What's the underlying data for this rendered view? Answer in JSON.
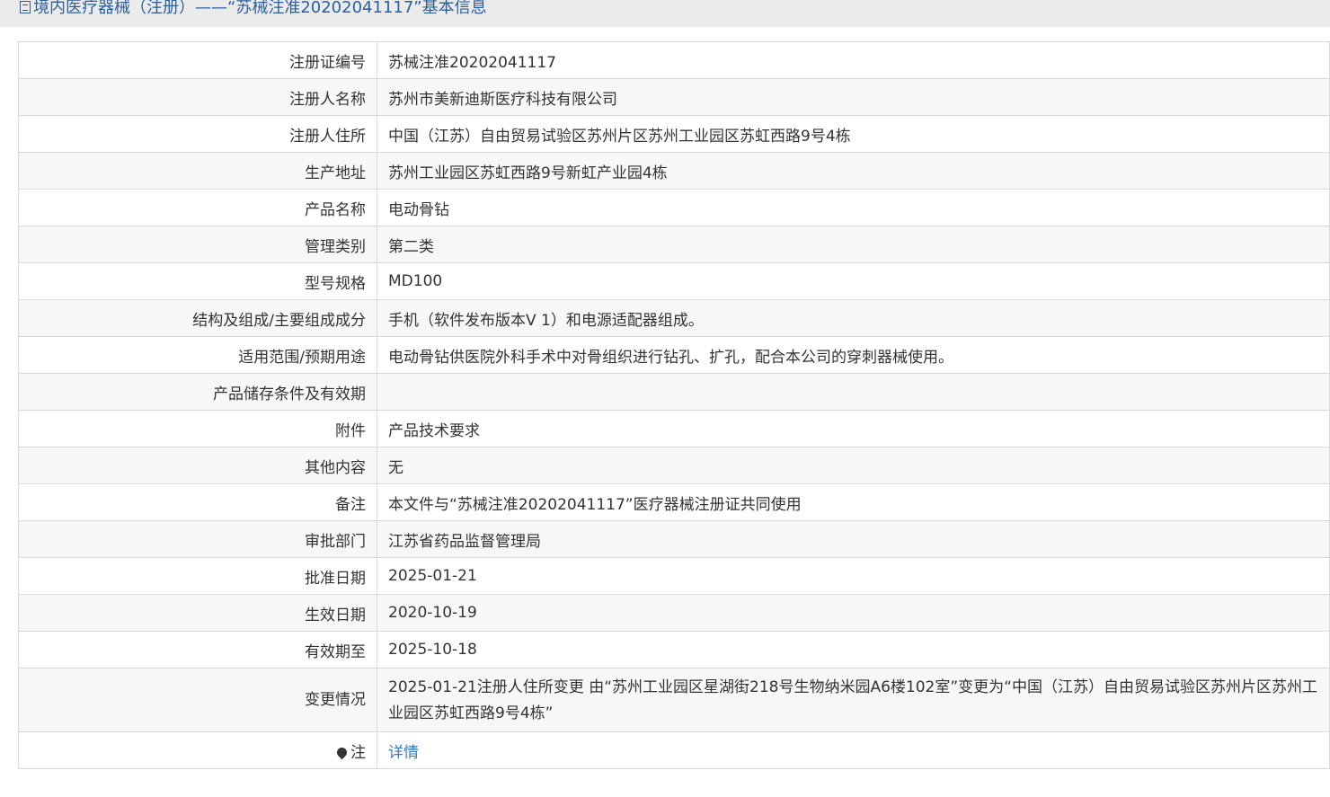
{
  "header": {
    "title": "境内医疗器械（注册）——“苏械注准20202041117”基本信息"
  },
  "rows": [
    {
      "label": "注册证编号",
      "value": "苏械注准20202041117"
    },
    {
      "label": "注册人名称",
      "value": "苏州市美新迪斯医疗科技有限公司"
    },
    {
      "label": "注册人住所",
      "value": "中国（江苏）自由贸易试验区苏州片区苏州工业园区苏虹西路9号4栋"
    },
    {
      "label": "生产地址",
      "value": "苏州工业园区苏虹西路9号新虹产业园4栋"
    },
    {
      "label": "产品名称",
      "value": "电动骨钻"
    },
    {
      "label": "管理类别",
      "value": "第二类"
    },
    {
      "label": "型号规格",
      "value": "MD100"
    },
    {
      "label": "结构及组成/主要组成成分",
      "value": "手机（软件发布版本V 1）和电源适配器组成。"
    },
    {
      "label": "适用范围/预期用途",
      "value": "电动骨钻供医院外科手术中对骨组织进行钻孔、扩孔，配合本公司的穿刺器械使用。"
    },
    {
      "label": "产品储存条件及有效期",
      "value": ""
    },
    {
      "label": "附件",
      "value": "产品技术要求"
    },
    {
      "label": "其他内容",
      "value": "无"
    },
    {
      "label": "备注",
      "value": "本文件与“苏械注准20202041117”医疗器械注册证共同使用"
    },
    {
      "label": "审批部门",
      "value": "江苏省药品监督管理局"
    },
    {
      "label": "批准日期",
      "value": "2025-01-21"
    },
    {
      "label": "生效日期",
      "value": "2020-10-19"
    },
    {
      "label": "有效期至",
      "value": "2025-10-18"
    },
    {
      "label": "变更情况",
      "value": "2025-01-21注册人住所变更 由“苏州工业园区星湖街218号生物纳米园A6楼102室”变更为“中国（江苏）自由贸易试验区苏州片区苏州工业园区苏虹西路9号4栋”"
    }
  ],
  "note_row": {
    "label": "注",
    "icon": "lightbulb-icon",
    "link_text": "详情"
  },
  "colors": {
    "header_bg": "#ebebeb",
    "title_color": "#2b5f9c",
    "link_color": "#3a78c3",
    "border": "#d9d9d9",
    "stripe": "#f7f7f7"
  }
}
